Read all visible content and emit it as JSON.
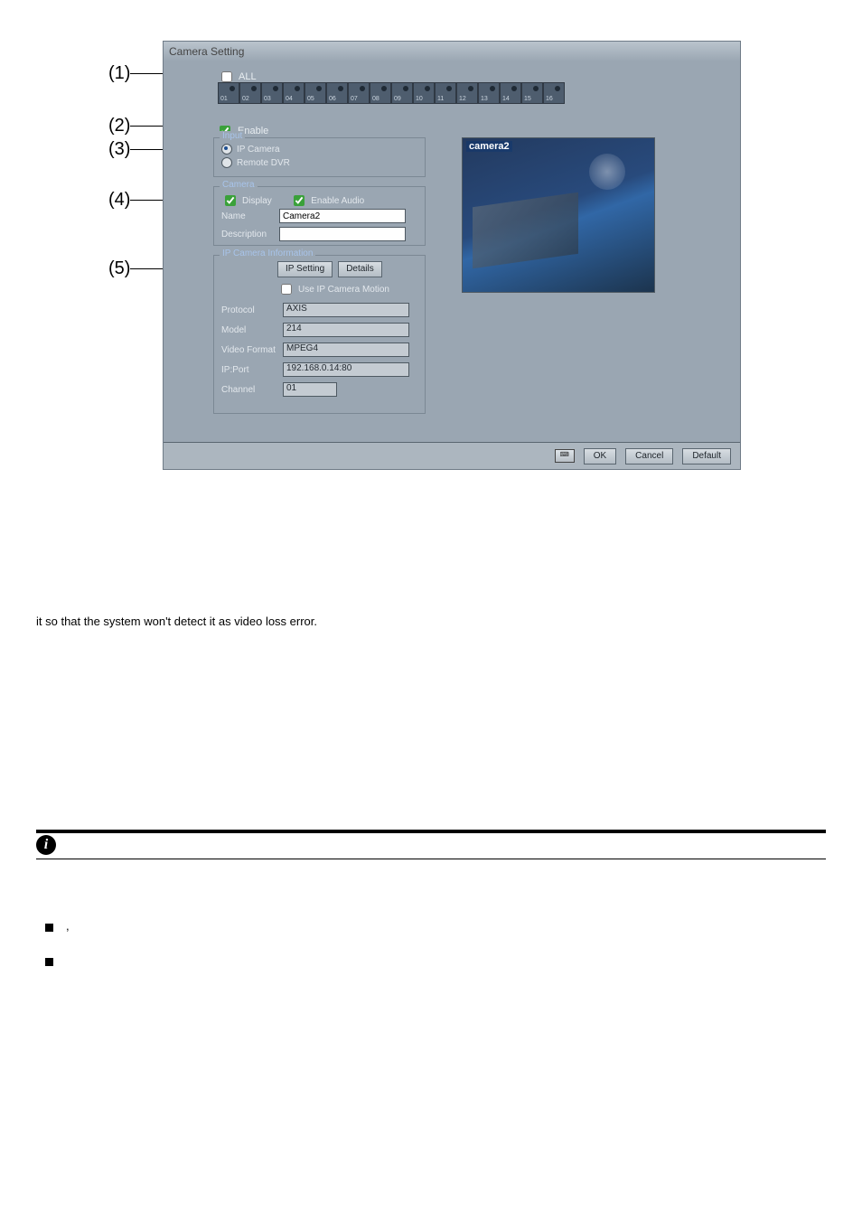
{
  "callouts": {
    "c1": "(1)",
    "c2": "(2)",
    "c3": "(3)",
    "c4": "(4)",
    "c5": "(5)"
  },
  "dialog": {
    "title": "Camera Setting",
    "allLabel": "ALL",
    "camNumbers": [
      "01",
      "02",
      "03",
      "04",
      "05",
      "06",
      "07",
      "08",
      "09",
      "10",
      "11",
      "12",
      "13",
      "14",
      "15",
      "16"
    ],
    "enableLabel": "Enable",
    "input": {
      "legend": "Input",
      "ipCameraLabel": "IP Camera",
      "remoteDvrLabel": "Remote DVR"
    },
    "camera": {
      "legend": "Camera",
      "displayLabel": "Display",
      "enableAudioLabel": "Enable Audio",
      "nameLabel": "Name",
      "nameValue": "Camera2",
      "descriptionLabel": "Description",
      "descriptionValue": ""
    },
    "preview": {
      "label": "camera2"
    },
    "ipInfo": {
      "legend": "IP Camera Information",
      "ipSettingButton": "IP Setting",
      "detailsButton": "Details",
      "useMotionLabel": "Use IP Camera Motion",
      "protocolLabel": "Protocol",
      "protocolValue": "AXIS",
      "modelLabel": "Model",
      "modelValue": "214",
      "videoFormatLabel": "Video Format",
      "videoFormatValue": "MPEG4",
      "ipPortLabel": "IP:Port",
      "ipPortValue": "192.168.0.14:80",
      "channelLabel": "Channel",
      "channelValue": "01"
    },
    "footer": {
      "ok": "OK",
      "cancel": "Cancel",
      "default": "Default"
    }
  },
  "text": {
    "p_videoLoss": "it so that the system won't detect it as video loss error.",
    "bullet1": ",",
    "bullet2": ""
  }
}
